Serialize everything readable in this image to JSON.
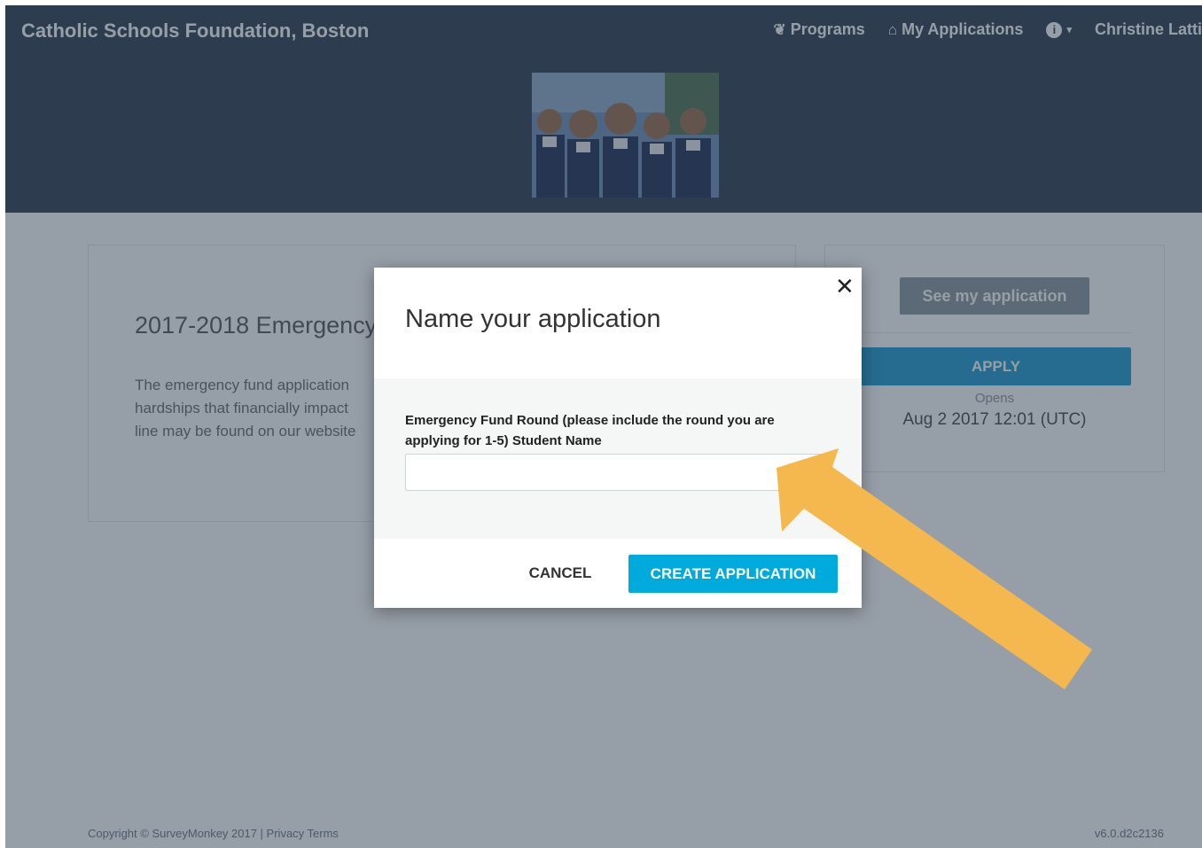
{
  "colors": {
    "header_bg": "#2c3d4f",
    "overlay": "rgba(45,62,80,0.5)",
    "accent_blue": "#00aadd",
    "apply_blue": "#1f9bd0",
    "arrow": "#f5b84e"
  },
  "header": {
    "brand": "Catholic Schools Foundation, Boston",
    "nav": {
      "programs_icon": "award-icon",
      "programs": "Programs",
      "my_applications_icon": "home-icon",
      "my_applications": "My Applications",
      "info_icon": "info-icon",
      "user": "Christine Latti"
    }
  },
  "program_card": {
    "title": "2017-2018 Emergency",
    "description": "The emergency fund application hardships that financially impact line may be found on our website"
  },
  "side_card": {
    "see_application": "See my application",
    "apply": "APPLY",
    "opens_label": "Opens",
    "opens_date": "Aug 2 2017 12:01 (UTC)"
  },
  "footer": {
    "copyright": "Copyright © SurveyMonkey 2017 | Privacy Terms",
    "version": "v6.0.d2c2136"
  },
  "modal": {
    "title": "Name your application",
    "close_symbol": "✕",
    "field_label": "Emergency Fund Round (please include the round you are applying for 1-5) Student Name",
    "field_value": "",
    "cancel": "CANCEL",
    "create": "CREATE APPLICATION"
  }
}
